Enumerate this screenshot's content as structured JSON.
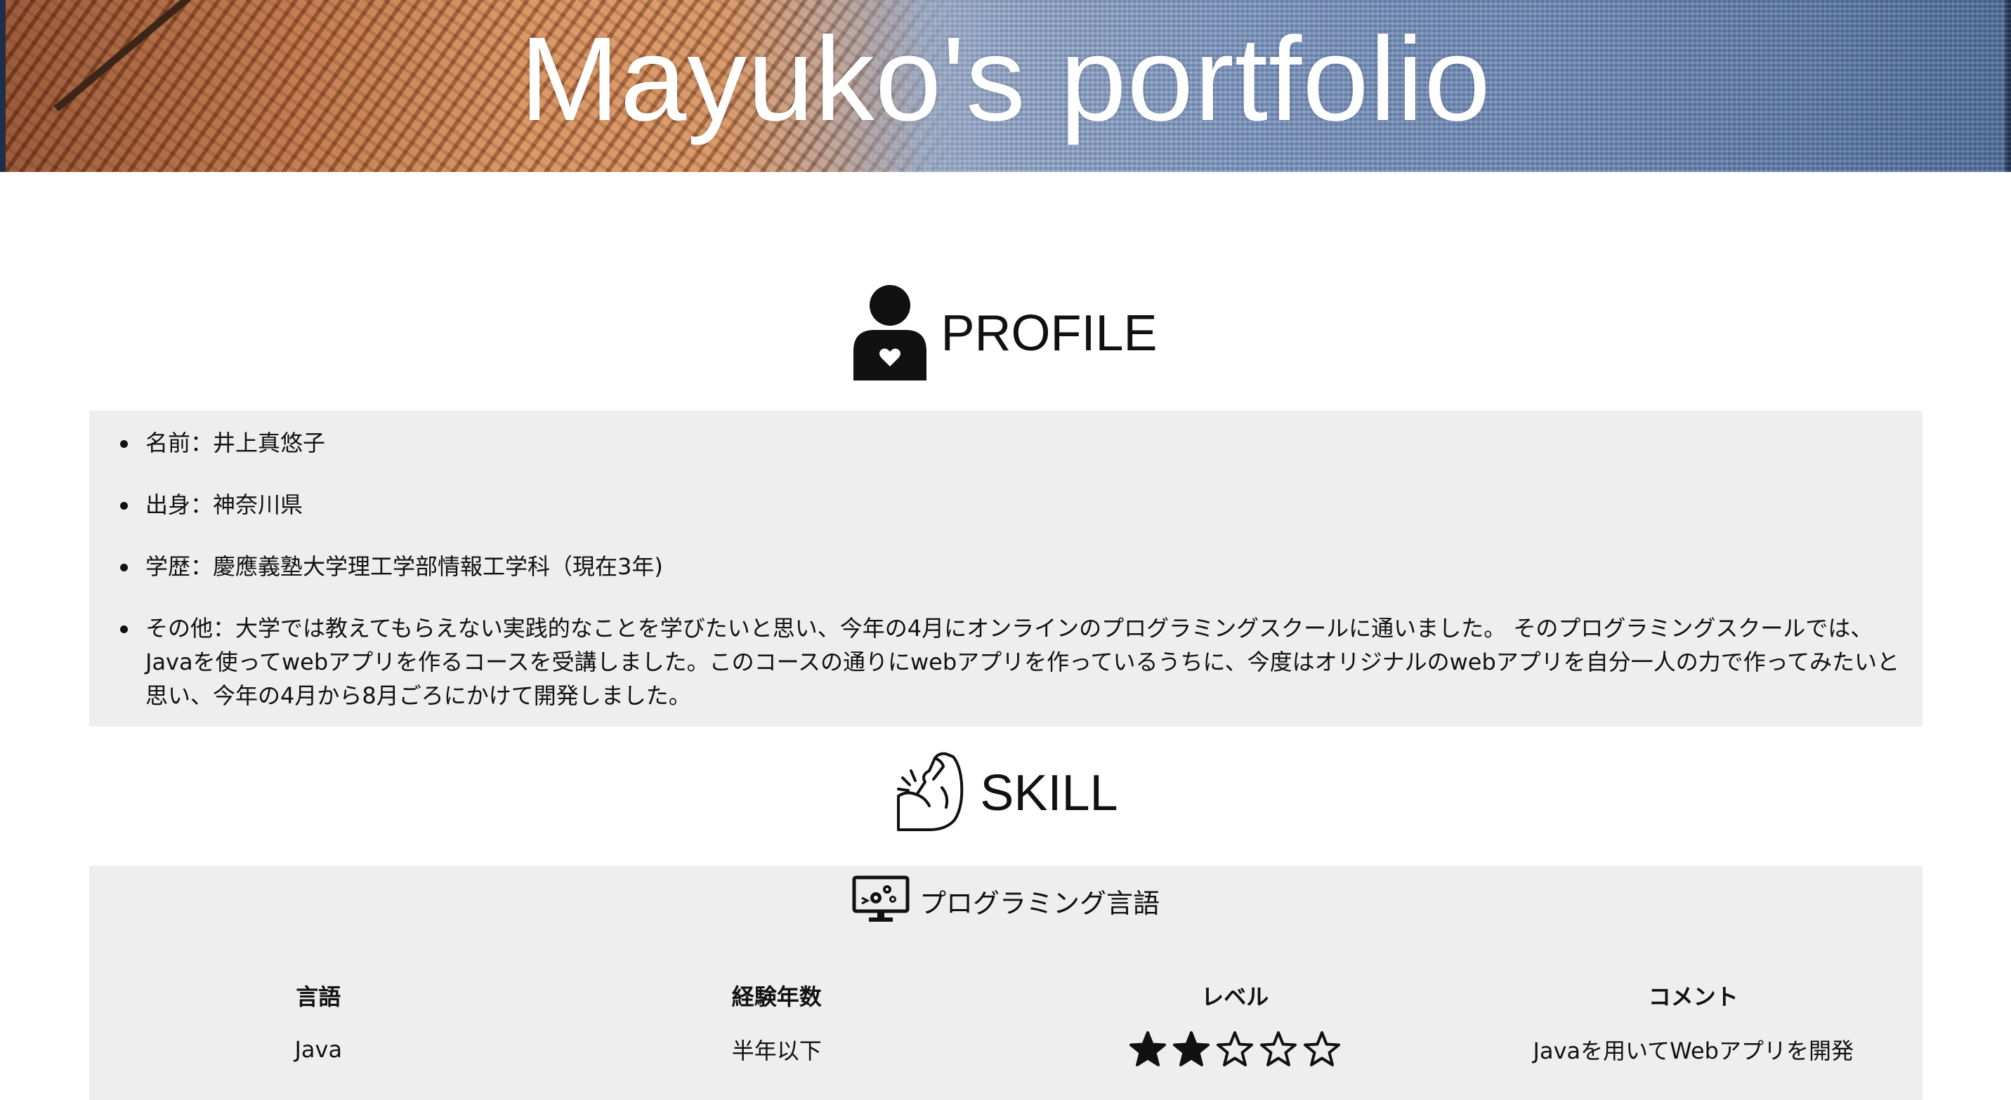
{
  "header": {
    "title": "Mayuko's portfolio"
  },
  "profile": {
    "heading": "PROFILE",
    "icon": "person-heart-icon",
    "items": [
      {
        "text": "名前：井上真悠子"
      },
      {
        "text": "出身：神奈川県"
      },
      {
        "text": "学歴：慶應義塾大学理工学部情報工学科（現在3年)"
      },
      {
        "text": "その他：大学では教えてもらえない実践的なことを学びたいと思い、今年の4月にオンラインのプログラミングスクールに通いました。 そのプログラミングスクールでは、Javaを使ってwebアプリを作るコースを受講しました。このコースの通りにwebアプリを作っているうちに、今度はオリジナルのwebアプリを自分一人の力で作ってみたいと思い、今年の4月から8月ごろにかけて開発しました。"
      }
    ]
  },
  "skill": {
    "heading": "SKILL",
    "icon": "flexed-arm-icon",
    "programming": {
      "heading": "プログラミング言語",
      "icon": "monitor-gears-icon",
      "columns": [
        "言語",
        "経験年数",
        "レベル",
        "コメント"
      ],
      "rows": [
        {
          "language": "Java",
          "years": "半年以下",
          "level": 2,
          "max_level": 5,
          "comment": "Javaを用いてWebアプリを開発"
        }
      ]
    }
  },
  "colors": {
    "panel_background": "#eeeeee",
    "text": "#111111",
    "title_text": "#ffffff"
  }
}
